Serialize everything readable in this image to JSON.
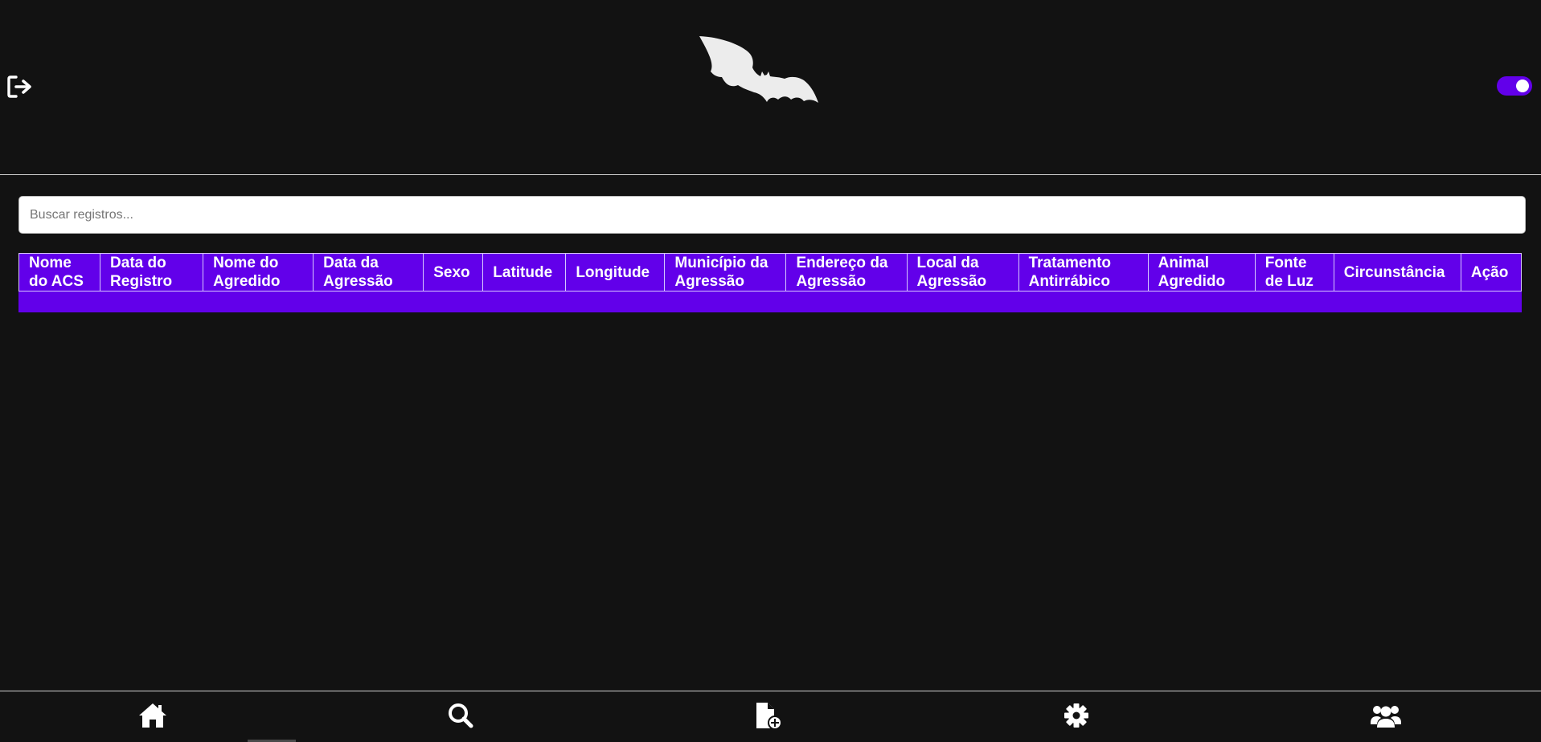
{
  "header": {
    "logout_icon": "logout-icon",
    "logo": "bat-logo",
    "theme_toggle_on": true,
    "accent_color": "#6200ea"
  },
  "search": {
    "placeholder": "Buscar registros...",
    "value": ""
  },
  "table": {
    "columns": [
      "Nome do ACS",
      "Data do Registro",
      "Nome do Agredido",
      "Data da Agressão",
      "Sexo",
      "Latitude",
      "Longitude",
      "Município da Agressão",
      "Endereço da Agressão",
      "Local da Agressão",
      "Tratamento Antirrábico",
      "Animal Agredido",
      "Fonte de Luz",
      "Circunstância",
      "Ação"
    ],
    "rows": []
  },
  "bottom_nav": {
    "items": [
      {
        "icon": "home-icon"
      },
      {
        "icon": "search-icon"
      },
      {
        "icon": "add-document-icon"
      },
      {
        "icon": "gear-icon"
      },
      {
        "icon": "users-icon"
      }
    ]
  }
}
